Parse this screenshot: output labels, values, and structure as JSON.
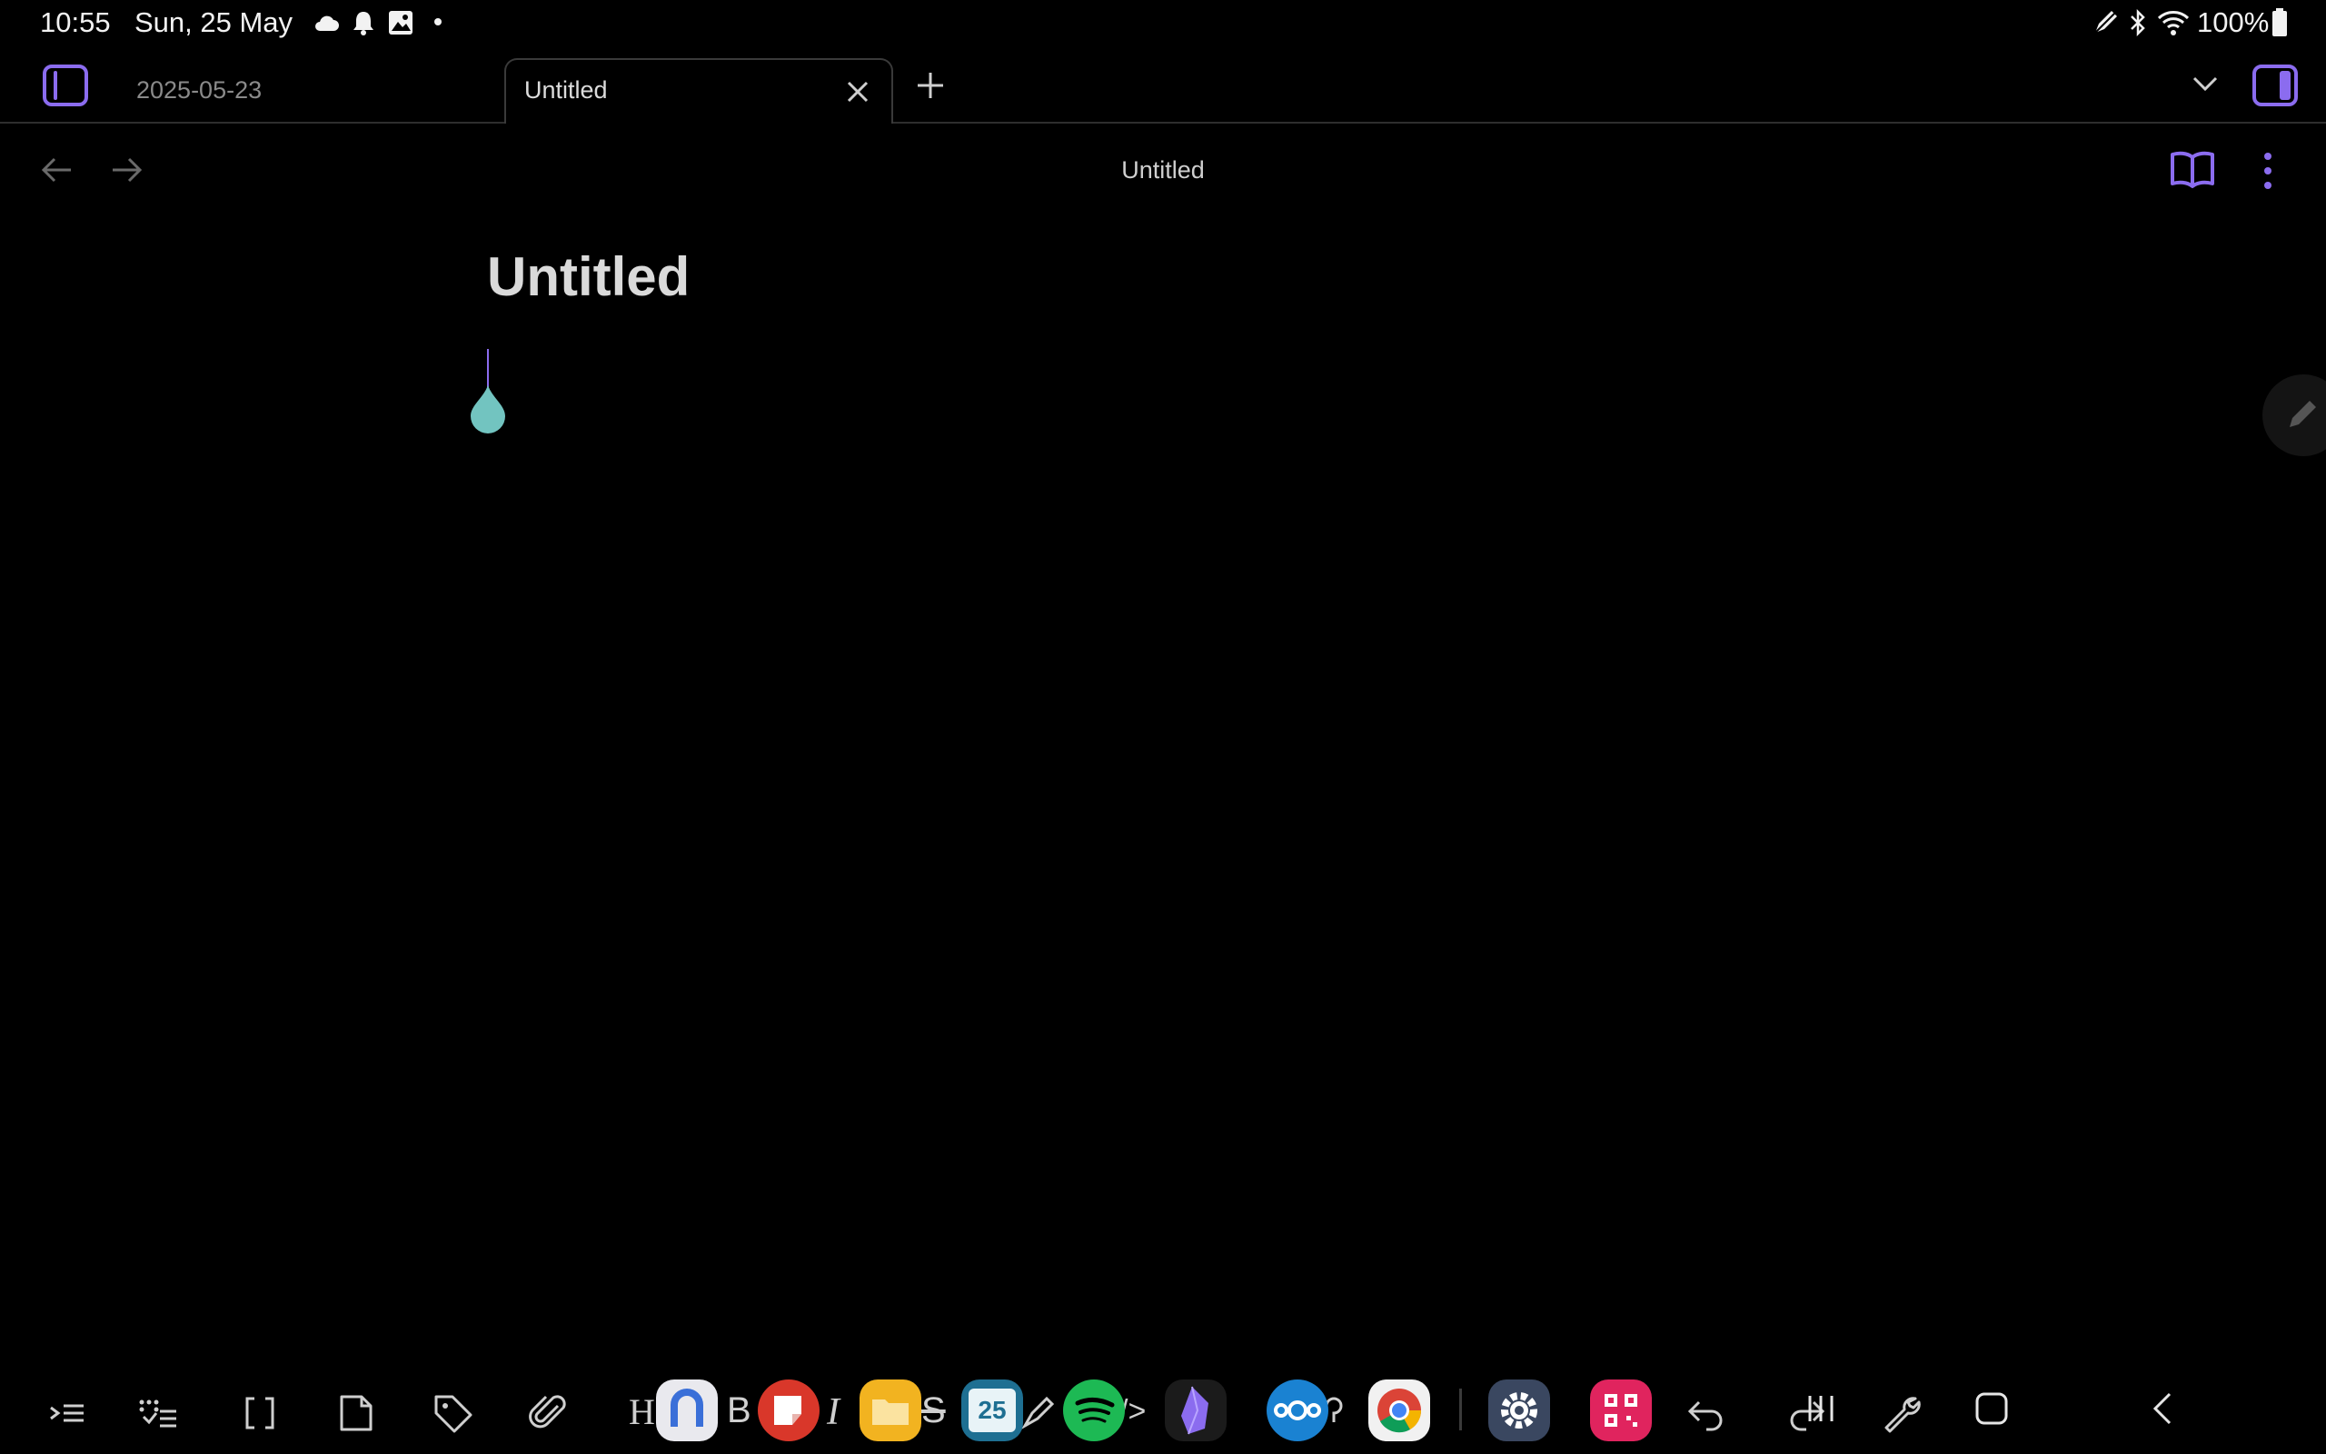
{
  "status_bar": {
    "time": "10:55",
    "date": "Sun, 25 May",
    "battery": "100%",
    "left_icons": [
      "cloud-icon",
      "bell-icon",
      "image-icon",
      "dot-icon"
    ],
    "right_icons": [
      "pen-icon",
      "bluetooth-icon",
      "wifi-icon",
      "battery-icon"
    ]
  },
  "tabs": [
    {
      "label": "2025-05-23",
      "active": false
    },
    {
      "label": "Untitled",
      "active": true
    }
  ],
  "nav": {
    "title": "Untitled"
  },
  "editor": {
    "title": "Untitled"
  },
  "toolbar_icons": [
    "indent-icon",
    "checklist-icon",
    "brackets-icon",
    "file-icon",
    "tag-icon",
    "paperclip-icon",
    "heading-icon",
    "bold-icon",
    "italic-icon",
    "strikethrough-icon",
    "highlight-icon",
    "code-icon",
    "quote-icon",
    "undo-icon",
    "redo-icon",
    "wrench-icon"
  ],
  "dock": {
    "apps": [
      "nova-app-icon",
      "notes-app-icon",
      "files-app-icon",
      "calendar-app-icon",
      "spotify-app-icon",
      "obsidian-app-icon",
      "nextcloud-app-icon",
      "chrome-app-icon",
      "settings-app-icon",
      "qr-app-icon"
    ],
    "calendar_day": "25"
  },
  "colors": {
    "accent": "#8b6cef",
    "cursor_handle": "#72c4c0",
    "background": "#000000"
  }
}
